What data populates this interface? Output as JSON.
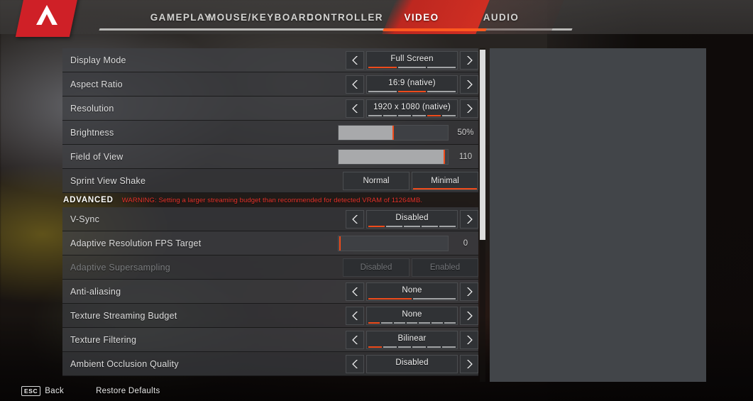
{
  "app": {
    "logo_icon": "apex-legends-logo-icon"
  },
  "nav": {
    "tabs": [
      {
        "label": "GAMEPLAY",
        "active": false
      },
      {
        "label": "MOUSE/KEYBOARD",
        "active": false
      },
      {
        "label": "CONTROLLER",
        "active": false
      },
      {
        "label": "VIDEO",
        "active": true
      },
      {
        "label": "AUDIO",
        "active": false
      }
    ]
  },
  "settings": {
    "rows": [
      {
        "type": "selector",
        "label": "Display Mode",
        "value": "Full Screen",
        "segments": 3,
        "selected_segment": 1
      },
      {
        "type": "selector",
        "label": "Aspect Ratio",
        "value": "16:9 (native)",
        "segments": 3,
        "selected_segment": 2
      },
      {
        "type": "selector",
        "label": "Resolution",
        "value": "1920 x 1080 (native)",
        "segments": 6,
        "selected_segment": 5
      },
      {
        "type": "slider",
        "label": "Brightness",
        "value": "50%",
        "fill_percent": 50
      },
      {
        "type": "slider",
        "label": "Field of View",
        "value": "110",
        "fill_percent": 97
      },
      {
        "type": "toggle",
        "label": "Sprint View Shake",
        "options": [
          "Normal",
          "Minimal"
        ],
        "selected": "Minimal"
      },
      {
        "type": "advanced_header",
        "label": "ADVANCED",
        "warning": "WARNING: Setting a larger streaming budget than recommended for detected VRAM of 11264MB."
      },
      {
        "type": "selector",
        "label": "V-Sync",
        "value": "Disabled",
        "segments": 5,
        "selected_segment": 1
      },
      {
        "type": "slider",
        "label": "Adaptive Resolution FPS Target",
        "value": "0",
        "fill_percent": 0
      },
      {
        "type": "toggle",
        "label": "Adaptive Supersampling",
        "options": [
          "Disabled",
          "Enabled"
        ],
        "selected": "",
        "disabled": true
      },
      {
        "type": "selector",
        "label": "Anti-aliasing",
        "value": "None",
        "segments": 2,
        "selected_segment": 1
      },
      {
        "type": "selector",
        "label": "Texture Streaming Budget",
        "value": "None",
        "segments": 7,
        "selected_segment": 1
      },
      {
        "type": "selector",
        "label": "Texture Filtering",
        "value": "Bilinear",
        "segments": 6,
        "selected_segment": 1
      },
      {
        "type": "selector",
        "label": "Ambient Occlusion Quality",
        "value": "Disabled",
        "segments": 0,
        "selected_segment": 0
      }
    ]
  },
  "bottom_bar": {
    "back_key": "ESC",
    "back_label": "Back",
    "restore_label": "Restore Defaults"
  },
  "colors": {
    "accent_orange": "#ef4b1b",
    "brand_red": "#cf2027",
    "warning_red": "#e8342c",
    "row_bg": "#3e4043",
    "panel_bg": "#424549"
  }
}
